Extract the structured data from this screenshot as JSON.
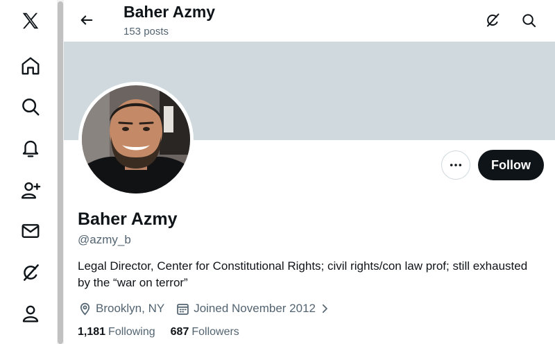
{
  "nav": {
    "items": [
      {
        "name": "x-logo-icon"
      },
      {
        "name": "home-icon"
      },
      {
        "name": "search-icon"
      },
      {
        "name": "notifications-icon"
      },
      {
        "name": "follow-icon"
      },
      {
        "name": "messages-icon"
      },
      {
        "name": "grok-icon"
      },
      {
        "name": "profile-icon"
      }
    ]
  },
  "header": {
    "title": "Baher Azmy",
    "posts": "153 posts"
  },
  "profile": {
    "name": "Baher Azmy",
    "handle": "@azmy_b",
    "bio": "Legal Director, Center for Constitutional Rights; civil rights/con law prof; still exhausted by the “war on terror”",
    "location": "Brooklyn, NY",
    "joined": "Joined November 2012",
    "following_count": "1,181",
    "following_label": "Following",
    "followers_count": "687",
    "followers_label": "Followers"
  },
  "actions": {
    "follow_label": "Follow",
    "more_label": "•••"
  },
  "colors": {
    "banner": "#cfd9de",
    "text": "#0f1419",
    "secondary": "#536471",
    "button": "#0f1419"
  }
}
